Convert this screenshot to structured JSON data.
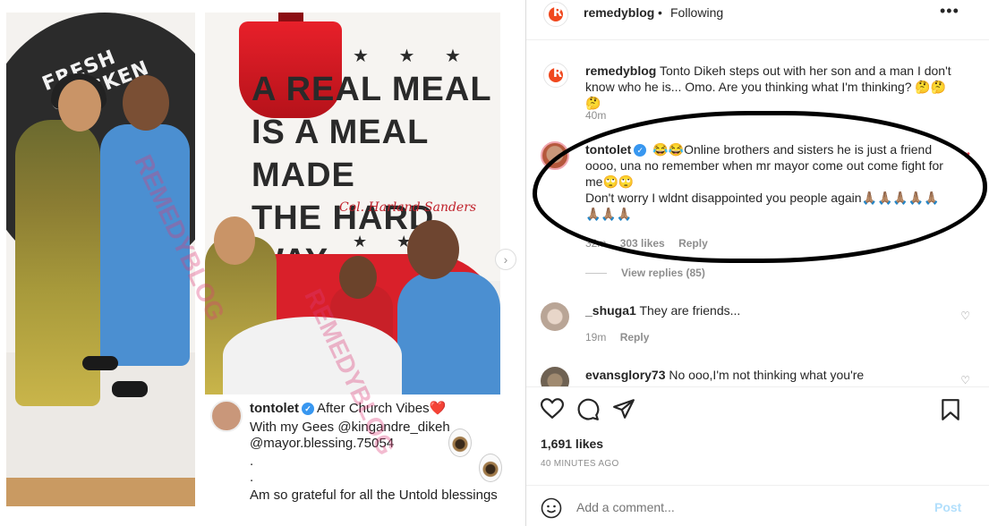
{
  "header": {
    "username": "remedyblog",
    "separator": "•",
    "follow_status": "Following",
    "more_icon": "more-horizontal-icon",
    "more_glyph": "•••"
  },
  "caption_comment": {
    "username": "remedyblog",
    "text": "Tonto Dikeh steps out with her son and a man I don't know who he is... Omo. Are you thinking what I'm thinking? 🤔🤔🤔",
    "time": "40m"
  },
  "comments": [
    {
      "username": "tontolet",
      "verified": true,
      "text_line1": "😂😂Online brothers and sisters he is just a friend oooo, una no remember when mr mayor come out come fight for me🙄🙄",
      "text_line2": "Don't worry I wldnt disappointed you people again🙏🏽🙏🏽🙏🏽🙏🏽🙏🏽🙏🏽🙏🏽🙏🏽",
      "time": "32m",
      "likes": "303 likes",
      "reply": "Reply",
      "liked": true,
      "view_replies": "View replies (85)"
    },
    {
      "username": "_shuga1",
      "text": "They are friends...",
      "time": "19m",
      "reply": "Reply",
      "liked": false
    },
    {
      "username": "evansglory73",
      "text": "No ooo,I'm not thinking what you're",
      "liked": false
    }
  ],
  "actions": {
    "like_icon": "heart-icon",
    "comment_icon": "comment-icon",
    "share_icon": "share-icon",
    "save_icon": "bookmark-icon"
  },
  "likes": "1,691 likes",
  "posted_ago": "40 MINUTES AGO",
  "add_comment": {
    "placeholder": "Add a comment...",
    "post_label": "Post"
  },
  "media": {
    "left_photo_sign": "FRESH CHICKEN",
    "slogan_lines": [
      "A REAL MEAL",
      "IS A MEAL MADE",
      "THE HARD WAY"
    ],
    "signature": "Col. Harland Sanders",
    "caption_user": "tontolet",
    "caption_title": "After Church Vibes",
    "caption_heart": "❤️",
    "caption_line1": "With my Gees @kingandre_dikeh",
    "caption_line2": "@mayor.blessing.75054",
    "caption_dot1": ".",
    "caption_dot2": ".",
    "caption_line3": "Am so grateful for all the Untold blessings",
    "watermark": "REMEDYBLOG",
    "next_glyph": "›"
  },
  "colors": {
    "accent": "#3897f0",
    "liked": "#ed4956",
    "muted": "#8e8e8e",
    "brand": "#f0481e"
  }
}
